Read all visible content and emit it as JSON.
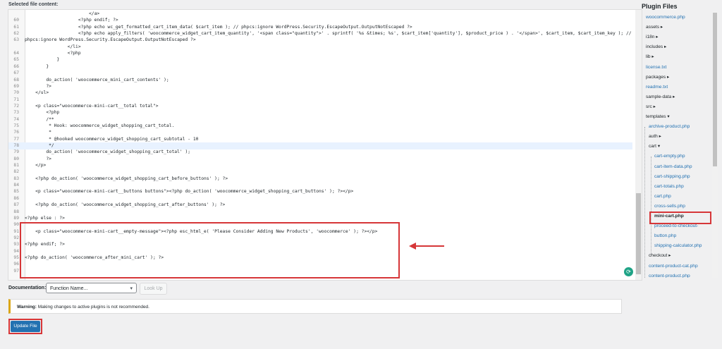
{
  "editor": {
    "label": "Selected file content:",
    "lines": [
      {
        "n": "",
        "t": "                        </a>",
        "hl": false
      },
      {
        "n": "60",
        "t": "                    <?php endif; ?>",
        "hl": false
      },
      {
        "n": "61",
        "t": "                    <?php echo wc_get_formatted_cart_item_data( $cart_item ); // phpcs:ignore WordPress.Security.EscapeOutput.OutputNotEscaped ?>",
        "hl": false
      },
      {
        "n": "62",
        "t": "                    <?php echo apply_filters( 'woocommerce_widget_cart_item_quantity', '<span class=\"quantity\">' . sprintf( '%s &times; %s', $cart_item['quantity'], $product_price ) . '</span>', $cart_item, $cart_item_key ); //",
        "hl": false
      },
      {
        "n": "63",
        "t": "phpcs:ignore WordPress.Security.EscapeOutput.OutputNotEscaped ?>",
        "hl": false
      },
      {
        "n": "",
        "t": "                </li>",
        "hl": false
      },
      {
        "n": "64",
        "t": "                <?php",
        "hl": false
      },
      {
        "n": "65",
        "t": "            }",
        "hl": false
      },
      {
        "n": "66",
        "t": "        }",
        "hl": false
      },
      {
        "n": "67",
        "t": "",
        "hl": false
      },
      {
        "n": "68",
        "t": "        do_action( 'woocommerce_mini_cart_contents' );",
        "hl": false
      },
      {
        "n": "69",
        "t": "        ?>",
        "hl": false
      },
      {
        "n": "70",
        "t": "    </ul>",
        "hl": false
      },
      {
        "n": "71",
        "t": "",
        "hl": false
      },
      {
        "n": "72",
        "t": "    <p class=\"woocommerce-mini-cart__total total\">",
        "hl": false
      },
      {
        "n": "73",
        "t": "        <?php",
        "hl": false
      },
      {
        "n": "74",
        "t": "        /**",
        "hl": false
      },
      {
        "n": "75",
        "t": "         * Hook: woocommerce_widget_shopping_cart_total.",
        "hl": false
      },
      {
        "n": "76",
        "t": "         *",
        "hl": false
      },
      {
        "n": "77",
        "t": "         * @hooked woocommerce_widget_shopping_cart_subtotal - 10",
        "hl": false
      },
      {
        "n": "78",
        "t": "         */",
        "hl": true
      },
      {
        "n": "79",
        "t": "        do_action( 'woocommerce_widget_shopping_cart_total' );",
        "hl": false
      },
      {
        "n": "80",
        "t": "        ?>",
        "hl": false
      },
      {
        "n": "81",
        "t": "    </p>",
        "hl": false
      },
      {
        "n": "82",
        "t": "",
        "hl": false
      },
      {
        "n": "83",
        "t": "    <?php do_action( 'woocommerce_widget_shopping_cart_before_buttons' ); ?>",
        "hl": false
      },
      {
        "n": "84",
        "t": "",
        "hl": false
      },
      {
        "n": "85",
        "t": "    <p class=\"woocommerce-mini-cart__buttons buttons\"><?php do_action( 'woocommerce_widget_shopping_cart_buttons' ); ?></p>",
        "hl": false
      },
      {
        "n": "86",
        "t": "",
        "hl": false
      },
      {
        "n": "87",
        "t": "    <?php do_action( 'woocommerce_widget_shopping_cart_after_buttons' ); ?>",
        "hl": false
      },
      {
        "n": "88",
        "t": "",
        "hl": false
      },
      {
        "n": "89",
        "t": "<?php else : ?>",
        "hl": false
      },
      {
        "n": "90",
        "t": "",
        "hl": false
      },
      {
        "n": "91",
        "t": "    <p class=\"woocommerce-mini-cart__empty-message\"><?php esc_html_e( 'Please Consider Adding New Products', 'woocommerce' ); ?></p>",
        "hl": false
      },
      {
        "n": "92",
        "t": "",
        "hl": false
      },
      {
        "n": "93",
        "t": "<?php endif; ?>",
        "hl": false
      },
      {
        "n": "94",
        "t": "",
        "hl": false
      },
      {
        "n": "95",
        "t": "<?php do_action( 'woocommerce_after_mini_cart' ); ?>",
        "hl": false
      },
      {
        "n": "96",
        "t": "",
        "hl": false
      },
      {
        "n": "97",
        "t": "",
        "hl": false
      }
    ]
  },
  "documentation": {
    "label": "Documentation:",
    "selected": "Function Name...",
    "lookup_label": "Look Up"
  },
  "warning": {
    "strong": "Warning:",
    "text": " Making changes to active plugins is not recommended."
  },
  "update_label": "Update File",
  "plugin_files": {
    "title": "Plugin Files",
    "items": [
      {
        "label": "woocommerce.php",
        "kind": "link",
        "indent": 0
      },
      {
        "label": "assets ▸",
        "kind": "folder",
        "indent": 0
      },
      {
        "label": "i18n ▸",
        "kind": "folder",
        "indent": 0
      },
      {
        "label": "includes ▸",
        "kind": "folder",
        "indent": 0
      },
      {
        "label": "lib ▸",
        "kind": "folder",
        "indent": 0
      },
      {
        "label": "license.txt",
        "kind": "link",
        "indent": 0
      },
      {
        "label": "packages ▸",
        "kind": "folder",
        "indent": 0
      },
      {
        "label": "readme.txt",
        "kind": "link",
        "indent": 0
      },
      {
        "label": "sample-data ▸",
        "kind": "folder",
        "indent": 0
      },
      {
        "label": "src ▸",
        "kind": "folder",
        "indent": 0
      },
      {
        "label": "templates ▾",
        "kind": "folder",
        "indent": 0
      },
      {
        "label": "archive-product.php",
        "kind": "link",
        "indent": 1
      },
      {
        "label": "auth ▸",
        "kind": "folder",
        "indent": 1
      },
      {
        "label": "cart ▾",
        "kind": "folder",
        "indent": 1
      },
      {
        "label": "cart-empty.php",
        "kind": "link",
        "indent": 2
      },
      {
        "label": "cart-item-data.php",
        "kind": "link",
        "indent": 2
      },
      {
        "label": "cart-shipping.php",
        "kind": "link",
        "indent": 2
      },
      {
        "label": "cart-totals.php",
        "kind": "link",
        "indent": 2
      },
      {
        "label": "cart.php",
        "kind": "link",
        "indent": 2
      },
      {
        "label": "cross-sells.php",
        "kind": "link",
        "indent": 2
      },
      {
        "label": "mini-cart.php",
        "kind": "active",
        "indent": 2
      },
      {
        "label": "proceed-to-checkout-",
        "kind": "link",
        "indent": 2
      },
      {
        "label": "button.php",
        "kind": "link",
        "indent": 2
      },
      {
        "label": "shipping-calculator.php",
        "kind": "link",
        "indent": 2
      },
      {
        "label": "checkout ▸",
        "kind": "folder",
        "indent": 1
      },
      {
        "label": "content-product-cat.php",
        "kind": "link",
        "indent": 1
      },
      {
        "label": "content-product.php",
        "kind": "link",
        "indent": 1
      }
    ]
  },
  "colors": {
    "accent": "#2271b1",
    "annotation_red": "#d63638",
    "warning_yellow": "#dba617"
  }
}
